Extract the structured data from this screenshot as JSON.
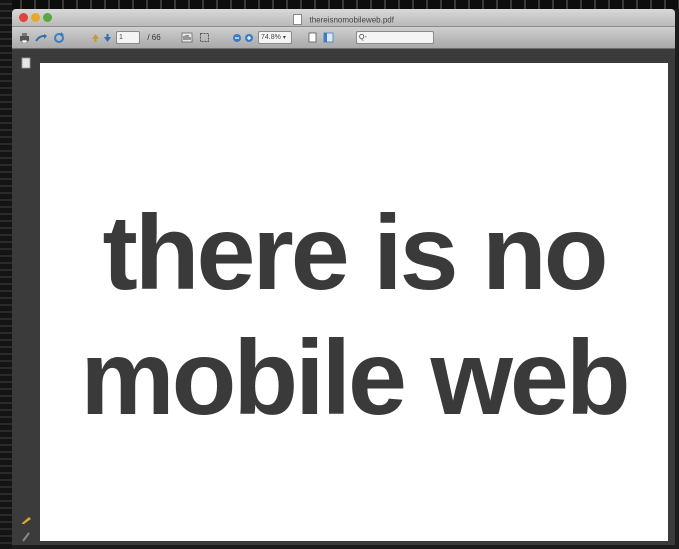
{
  "window": {
    "title": "thereisnomobileweb.pdf"
  },
  "toolbar": {
    "page_number": "1",
    "page_total": "/ 66",
    "zoom_value": "74.8%",
    "search_placeholder": "Q-"
  },
  "slide": {
    "line1": "there is no",
    "line2": "mobile web"
  },
  "colors": {
    "slide_text": "#3a3a3a",
    "slide_background": "#ffffff",
    "viewer_background": "#3b3b3b"
  }
}
